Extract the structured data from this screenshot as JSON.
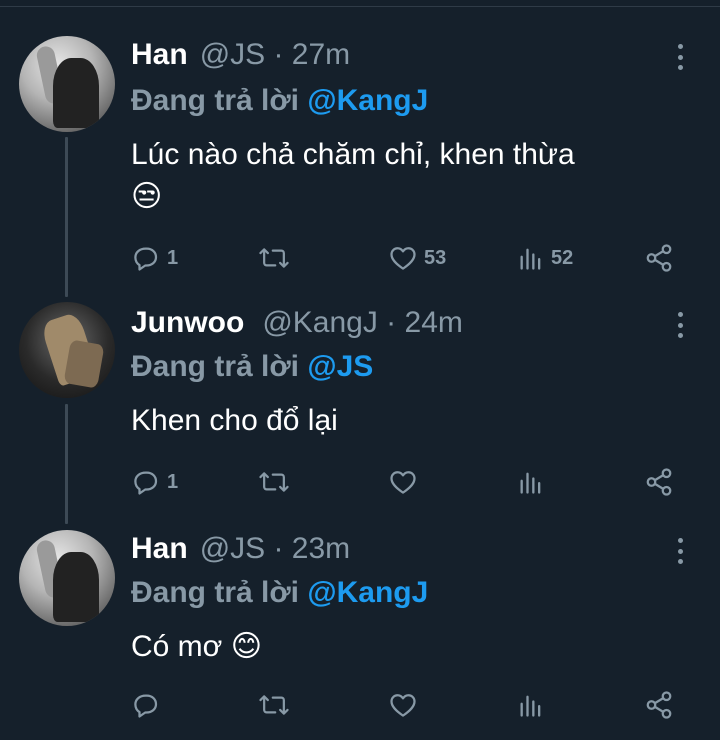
{
  "tweets": [
    {
      "name": "Han",
      "meta": "@JS · 27m",
      "replying_prefix": "Đang trả lời ",
      "replying_to": "@KangJ",
      "text": "Lúc nào chả chăm chỉ, khen thừa",
      "emoji": "😒",
      "counts": {
        "reply": "1",
        "retweet": "",
        "like": "53",
        "views": "52"
      }
    },
    {
      "name": "Junwoo",
      "meta": "@KangJ · 24m",
      "replying_prefix": "Đang trả lời ",
      "replying_to": "@JS",
      "text": "Khen cho đổ lại",
      "emoji": "",
      "counts": {
        "reply": "1",
        "retweet": "",
        "like": "",
        "views": ""
      }
    },
    {
      "name": "Han",
      "meta": "@JS · 23m",
      "replying_prefix": "Đang trả lời ",
      "replying_to": "@KangJ",
      "text": "Có mơ",
      "emoji": "😊",
      "counts": {
        "reply": "",
        "retweet": "",
        "like": "",
        "views": ""
      }
    }
  ],
  "icons": {
    "reply": "reply-icon",
    "retweet": "retweet-icon",
    "like": "heart-icon",
    "views": "views-icon",
    "share": "share-icon",
    "more": "more-vertical-icon"
  },
  "colors": {
    "background": "#15202b",
    "text": "#ffffff",
    "muted": "#8899a6",
    "mention": "#1d9bf0"
  }
}
